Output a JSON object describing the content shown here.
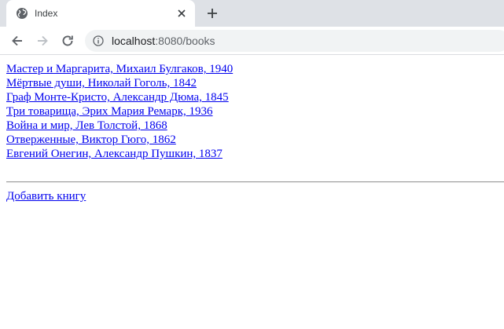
{
  "browser": {
    "tab_title": "Index",
    "url_host": "localhost",
    "url_rest": ":8080/books"
  },
  "icons": {
    "favicon": "globe-icon",
    "tab_close": "close-icon",
    "new_tab": "plus-icon",
    "back": "back-arrow-icon",
    "forward": "forward-arrow-icon",
    "reload": "reload-icon",
    "site_info": "info-icon"
  },
  "page": {
    "books": [
      "Мастер и Маргарита, Михаил Булгаков, 1940",
      "Мёртвые души, Николай Гоголь, 1842",
      "Граф Монте-Кристо, Александр Дюма, 1845",
      "Три товарища, Эрих Мария Ремарк, 1936",
      "Война и мир, Лев Толстой, 1868",
      "Отверженные, Виктор Гюго, 1862",
      "Евгений Онегин, Александр Пушкин, 1837"
    ],
    "add_book_label": "Добавить книгу"
  },
  "colors": {
    "link": "#0000ee",
    "tabstrip": "#dee1e6",
    "omnibox": "#f1f3f4"
  }
}
